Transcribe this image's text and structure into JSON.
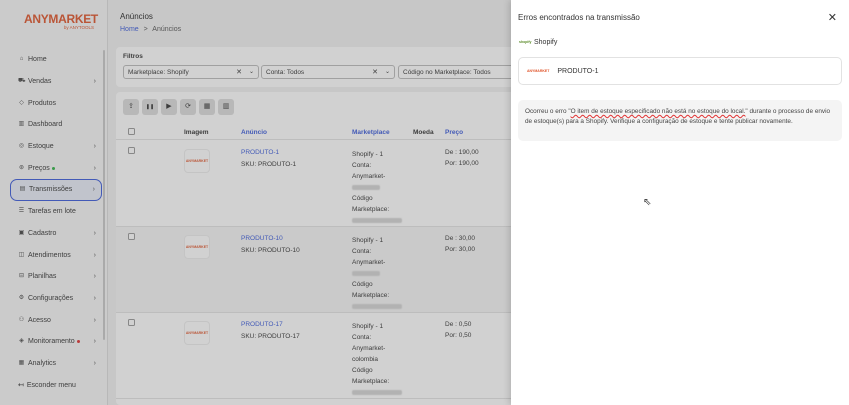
{
  "brand": {
    "logo_main": "ANYMARKET",
    "logo_sub": "by ANYTOOLS"
  },
  "sidebar": {
    "items": [
      {
        "label": "Home",
        "icon": "home-icon",
        "glyph": "⌂",
        "chevron": false,
        "dot": null,
        "active": false
      },
      {
        "label": "Vendas",
        "icon": "cart-icon",
        "glyph": "⛟",
        "chevron": true,
        "dot": null,
        "active": false
      },
      {
        "label": "Produtos",
        "icon": "tag-icon",
        "glyph": "◇",
        "chevron": false,
        "dot": null,
        "active": false
      },
      {
        "label": "Dashboard",
        "icon": "bar-chart-icon",
        "glyph": "▥",
        "chevron": false,
        "dot": null,
        "active": false
      },
      {
        "label": "Estoque",
        "icon": "stock-icon",
        "glyph": "◎",
        "chevron": true,
        "dot": null,
        "active": false
      },
      {
        "label": "Preços",
        "icon": "price-icon",
        "glyph": "⊛",
        "chevron": true,
        "dot": "green",
        "active": false
      },
      {
        "label": "Transmissões",
        "icon": "transmission-icon",
        "glyph": "▤",
        "chevron": true,
        "dot": null,
        "active": true
      },
      {
        "label": "Tarefas em lote",
        "icon": "tasks-icon",
        "glyph": "☰",
        "chevron": false,
        "dot": null,
        "active": false
      },
      {
        "label": "Cadastro",
        "icon": "register-icon",
        "glyph": "▣",
        "chevron": true,
        "dot": null,
        "active": false
      },
      {
        "label": "Atendimentos",
        "icon": "chat-icon",
        "glyph": "◫",
        "chevron": true,
        "dot": null,
        "active": false
      },
      {
        "label": "Planilhas",
        "icon": "spreadsheet-icon",
        "glyph": "⊟",
        "chevron": true,
        "dot": null,
        "active": false
      },
      {
        "label": "Configurações",
        "icon": "gear-icon",
        "glyph": "⚙",
        "chevron": true,
        "dot": null,
        "active": false
      },
      {
        "label": "Acesso",
        "icon": "users-icon",
        "glyph": "⚇",
        "chevron": true,
        "dot": null,
        "active": false
      },
      {
        "label": "Monitoramento",
        "icon": "monitor-icon",
        "glyph": "◈",
        "chevron": true,
        "dot": "red",
        "active": false
      },
      {
        "label": "Analytics",
        "icon": "analytics-icon",
        "glyph": "▦",
        "chevron": true,
        "dot": null,
        "active": false
      }
    ],
    "collapse_label": "Esconder menu"
  },
  "header": {
    "title": "Anúncios",
    "breadcrumb_home": "Home",
    "breadcrumb_sep": ">",
    "breadcrumb_current": "Anúncios"
  },
  "filters": {
    "label": "Filtros",
    "marketplace": "Marketplace: Shopify",
    "conta": "Conta: Todos",
    "codigo": "Código no Marketplace: Todos"
  },
  "toolbar": [
    "upload-icon",
    "pause-icon",
    "play-icon",
    "sync-icon",
    "trash-icon",
    "delete-icon"
  ],
  "table": {
    "headers": {
      "imagem": "Imagem",
      "anuncio": "Anúncio",
      "marketplace": "Marketplace",
      "moeda": "Moeda",
      "preco": "Preço"
    },
    "rows": [
      {
        "name": "PRODUTO-1",
        "sku": "SKU: PRODUTO-1",
        "mk": "Shopify - 1",
        "conta": "Conta:",
        "conta_val": "Anymarket-",
        "codigo": "Código",
        "codigo2": "Marketplace:",
        "de": "De : 190,00",
        "por": "Por: 190,00"
      },
      {
        "name": "PRODUTO-10",
        "sku": "SKU: PRODUTO-10",
        "mk": "Shopify - 1",
        "conta": "Conta:",
        "conta_val": "Anymarket-",
        "codigo": "Código",
        "codigo2": "Marketplace:",
        "de": "De : 30,00",
        "por": "Por: 30,00"
      },
      {
        "name": "PRODUTO-17",
        "sku": "SKU: PRODUTO-17",
        "mk": "Shopify - 1",
        "conta": "Conta:",
        "conta_val": "Anymarket-",
        "conta_val2": "colombia",
        "codigo": "Código",
        "codigo2": "Marketplace:",
        "de": "De : 0,50",
        "por": "Por: 0,50"
      }
    ],
    "thumb_text": "ANYMARKET"
  },
  "drawer": {
    "title": "Erros encontrados na transmissão",
    "store_logo": "shopify",
    "store": "Shopify",
    "product": "PRODUTO-1",
    "msg_prefix": "Ocorreu o erro \"",
    "msg_error": "O item de estoque especificado não está no estoque do local.",
    "msg_suffix": "\" durante o processo de envio de estoque(s) para a Shopify. Verifique a configuração de estoque e tente publicar novamente."
  }
}
